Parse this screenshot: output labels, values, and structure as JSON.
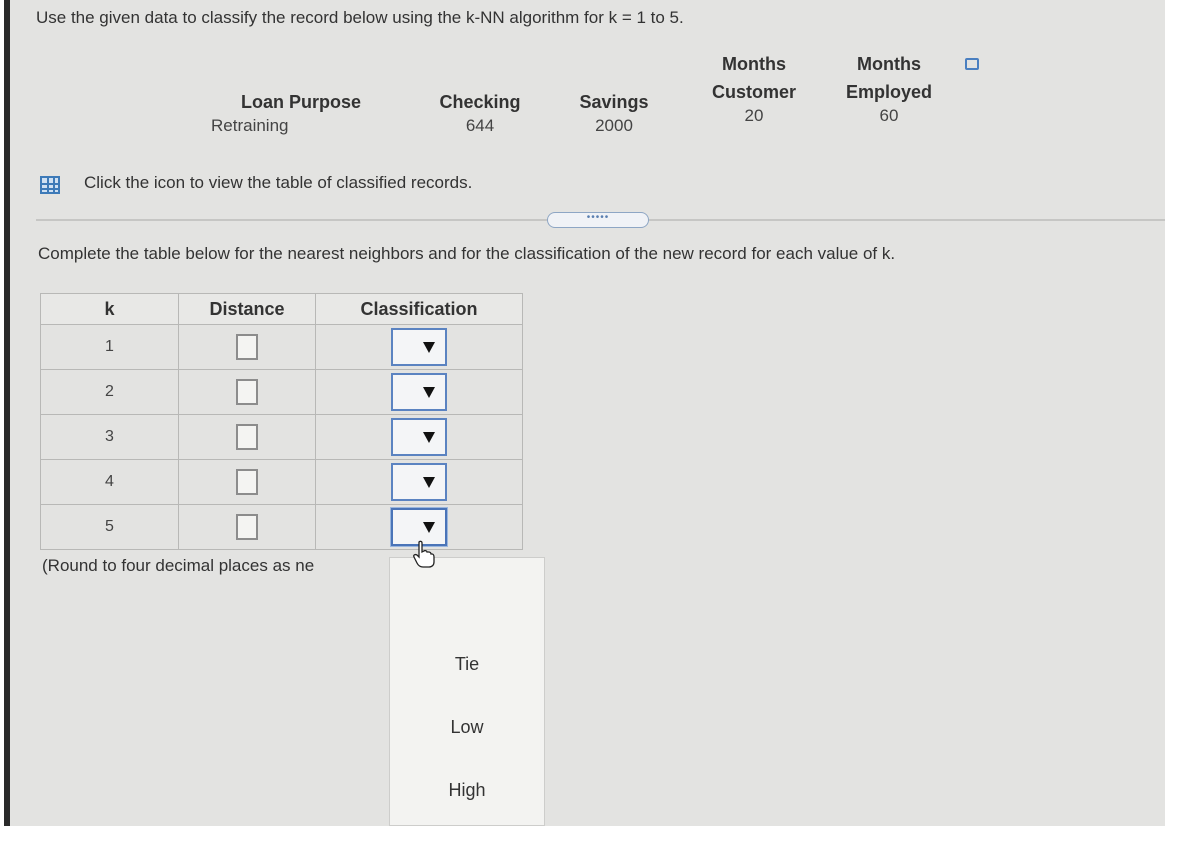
{
  "prompt": "Use the given data to classify the record below using the k-NN algorithm for k = 1 to 5.",
  "record": {
    "columns": [
      {
        "header_line1": "",
        "header_line2": "Loan Purpose",
        "value": "Retraining"
      },
      {
        "header_line1": "",
        "header_line2": "Checking",
        "value": "644"
      },
      {
        "header_line1": "",
        "header_line2": "Savings",
        "value": "2000"
      },
      {
        "header_line1": "Months",
        "header_line2": "Customer",
        "value": "20"
      },
      {
        "header_line1": "Months",
        "header_line2": "Employed",
        "value": "60"
      }
    ]
  },
  "icon_link_text": "Click the icon to view the table of classified records.",
  "instruction": "Complete the table below for the nearest neighbors and for the classification of the new record for each value of k.",
  "table": {
    "headers": [
      "k",
      "Distance",
      "Classification"
    ],
    "rows": [
      {
        "k": "1",
        "distance": "",
        "classification": ""
      },
      {
        "k": "2",
        "distance": "",
        "classification": ""
      },
      {
        "k": "3",
        "distance": "",
        "classification": ""
      },
      {
        "k": "4",
        "distance": "",
        "classification": ""
      },
      {
        "k": "5",
        "distance": "",
        "classification": ""
      }
    ]
  },
  "round_note": "(Round to four decimal places as ne",
  "dropdown_options": [
    "Tie",
    "Low",
    "High"
  ],
  "dots_label": "•••••",
  "icons": {
    "table_icon": "grid-table-icon",
    "copy_icon": "copy-icon",
    "dropdown_arrow": "triangle-down-icon",
    "cursor": "hand-pointer-icon"
  },
  "colors": {
    "background": "#e3e3e1",
    "accent_blue": "#4a74b8"
  }
}
